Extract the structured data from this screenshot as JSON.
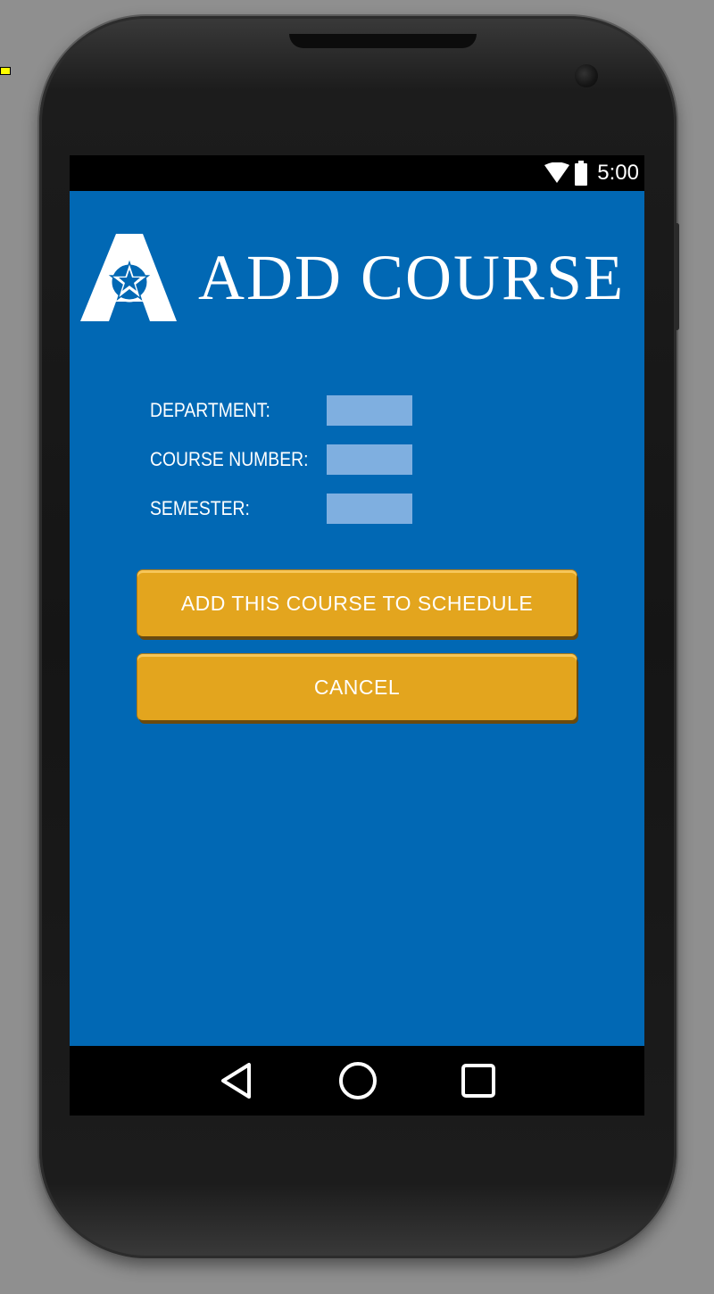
{
  "status_bar": {
    "time": "5:00",
    "icons": [
      "wifi-icon",
      "battery-icon"
    ]
  },
  "header": {
    "title": "ADD COURSE",
    "logo_icon": "uta-star-a-logo"
  },
  "form": {
    "department_label": "DEPARTMENT:",
    "department_value": "",
    "course_number_label": "COURSE NUMBER:",
    "course_number_value": "",
    "semester_label": "SEMESTER:",
    "semester_value": ""
  },
  "actions": {
    "add_label": "ADD THIS COURSE TO SCHEDULE",
    "cancel_label": "CANCEL"
  },
  "nav_bar": {
    "icons": [
      "back-icon",
      "home-icon",
      "recents-icon"
    ]
  },
  "colors": {
    "app_background": "#0168b4",
    "input_background": "#7fafe0",
    "button_background": "#e3a51e",
    "text": "#ffffff"
  }
}
